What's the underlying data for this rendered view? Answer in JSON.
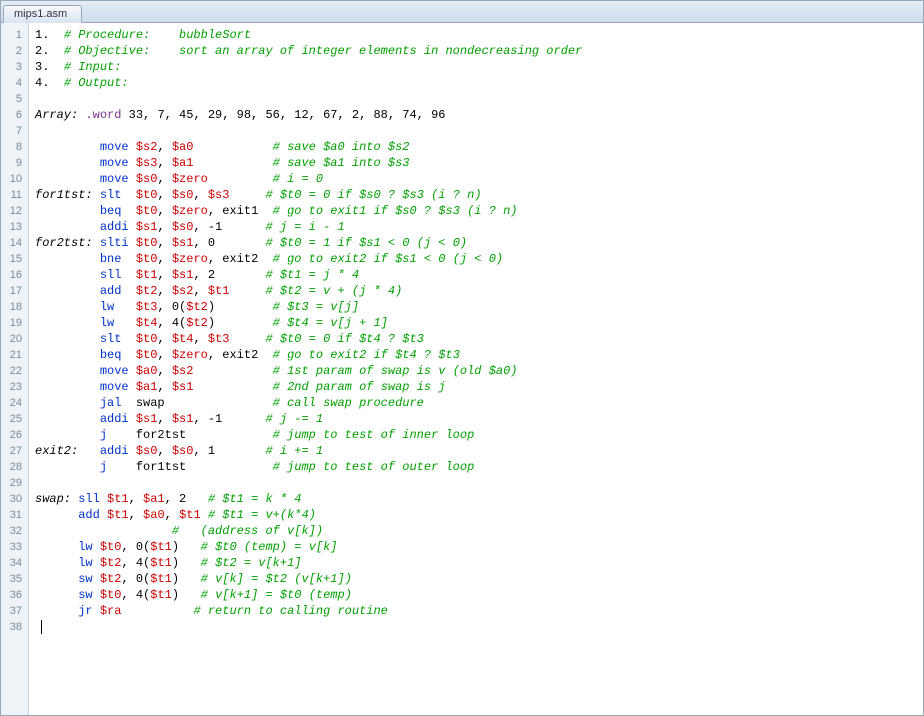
{
  "tab": {
    "label": "mips1.asm"
  },
  "gutter": [
    "1",
    "2",
    "3",
    "4",
    "5",
    "6",
    "7",
    "8",
    "9",
    "10",
    "11",
    "12",
    "13",
    "14",
    "15",
    "16",
    "17",
    "18",
    "19",
    "20",
    "21",
    "22",
    "23",
    "24",
    "25",
    "26",
    "27",
    "28",
    "29",
    "30",
    "31",
    "32",
    "33",
    "34",
    "35",
    "36",
    "37",
    "38"
  ],
  "lines": [
    [
      [
        "num",
        "1.  "
      ],
      [
        "comment",
        "# Procedure:    bubbleSort"
      ]
    ],
    [
      [
        "num",
        "2.  "
      ],
      [
        "comment",
        "# Objective:    sort an array of integer elements in nondecreasing order"
      ]
    ],
    [
      [
        "num",
        "3.  "
      ],
      [
        "comment",
        "# Input:"
      ]
    ],
    [
      [
        "num",
        "4.  "
      ],
      [
        "comment",
        "# Output:"
      ]
    ],
    [],
    [
      [
        "label",
        "Array:"
      ],
      [
        "plain",
        " "
      ],
      [
        "dir",
        ".word"
      ],
      [
        "plain",
        " 33, 7, 45, 29, 98, 56, 12, 67, 2, 88, 74, 96"
      ]
    ],
    [],
    [
      [
        "plain",
        "         "
      ],
      [
        "op",
        "move"
      ],
      [
        "plain",
        " "
      ],
      [
        "reg",
        "$s2"
      ],
      [
        "plain",
        ", "
      ],
      [
        "reg",
        "$a0"
      ],
      [
        "plain",
        "           "
      ],
      [
        "comment",
        "# save $a0 into $s2"
      ]
    ],
    [
      [
        "plain",
        "         "
      ],
      [
        "op",
        "move"
      ],
      [
        "plain",
        " "
      ],
      [
        "reg",
        "$s3"
      ],
      [
        "plain",
        ", "
      ],
      [
        "reg",
        "$a1"
      ],
      [
        "plain",
        "           "
      ],
      [
        "comment",
        "# save $a1 into $s3"
      ]
    ],
    [
      [
        "plain",
        "         "
      ],
      [
        "op",
        "move"
      ],
      [
        "plain",
        " "
      ],
      [
        "reg",
        "$s0"
      ],
      [
        "plain",
        ", "
      ],
      [
        "reg",
        "$zero"
      ],
      [
        "plain",
        "         "
      ],
      [
        "comment",
        "# i = 0"
      ]
    ],
    [
      [
        "label",
        "for1tst:"
      ],
      [
        "plain",
        " "
      ],
      [
        "op",
        "slt"
      ],
      [
        "plain",
        "  "
      ],
      [
        "reg",
        "$t0"
      ],
      [
        "plain",
        ", "
      ],
      [
        "reg",
        "$s0"
      ],
      [
        "plain",
        ", "
      ],
      [
        "reg",
        "$s3"
      ],
      [
        "plain",
        "     "
      ],
      [
        "comment",
        "# $t0 = 0 if $s0 ? $s3 (i ? n)"
      ]
    ],
    [
      [
        "plain",
        "         "
      ],
      [
        "op",
        "beq"
      ],
      [
        "plain",
        "  "
      ],
      [
        "reg",
        "$t0"
      ],
      [
        "plain",
        ", "
      ],
      [
        "reg",
        "$zero"
      ],
      [
        "plain",
        ", exit1  "
      ],
      [
        "comment",
        "# go to exit1 if $s0 ? $s3 (i ? n)"
      ]
    ],
    [
      [
        "plain",
        "         "
      ],
      [
        "op",
        "addi"
      ],
      [
        "plain",
        " "
      ],
      [
        "reg",
        "$s1"
      ],
      [
        "plain",
        ", "
      ],
      [
        "reg",
        "$s0"
      ],
      [
        "plain",
        ", -1      "
      ],
      [
        "comment",
        "# j = i - 1"
      ]
    ],
    [
      [
        "label",
        "for2tst:"
      ],
      [
        "plain",
        " "
      ],
      [
        "op",
        "slti"
      ],
      [
        "plain",
        " "
      ],
      [
        "reg",
        "$t0"
      ],
      [
        "plain",
        ", "
      ],
      [
        "reg",
        "$s1"
      ],
      [
        "plain",
        ", 0       "
      ],
      [
        "comment",
        "# $t0 = 1 if $s1 < 0 (j < 0)"
      ]
    ],
    [
      [
        "plain",
        "         "
      ],
      [
        "op",
        "bne"
      ],
      [
        "plain",
        "  "
      ],
      [
        "reg",
        "$t0"
      ],
      [
        "plain",
        ", "
      ],
      [
        "reg",
        "$zero"
      ],
      [
        "plain",
        ", exit2  "
      ],
      [
        "comment",
        "# go to exit2 if $s1 < 0 (j < 0)"
      ]
    ],
    [
      [
        "plain",
        "         "
      ],
      [
        "op",
        "sll"
      ],
      [
        "plain",
        "  "
      ],
      [
        "reg",
        "$t1"
      ],
      [
        "plain",
        ", "
      ],
      [
        "reg",
        "$s1"
      ],
      [
        "plain",
        ", 2       "
      ],
      [
        "comment",
        "# $t1 = j * 4"
      ]
    ],
    [
      [
        "plain",
        "         "
      ],
      [
        "op",
        "add"
      ],
      [
        "plain",
        "  "
      ],
      [
        "reg",
        "$t2"
      ],
      [
        "plain",
        ", "
      ],
      [
        "reg",
        "$s2"
      ],
      [
        "plain",
        ", "
      ],
      [
        "reg",
        "$t1"
      ],
      [
        "plain",
        "     "
      ],
      [
        "comment",
        "# $t2 = v + (j * 4)"
      ]
    ],
    [
      [
        "plain",
        "         "
      ],
      [
        "op",
        "lw"
      ],
      [
        "plain",
        "   "
      ],
      [
        "reg",
        "$t3"
      ],
      [
        "plain",
        ", 0("
      ],
      [
        "reg",
        "$t2"
      ],
      [
        "plain",
        ")        "
      ],
      [
        "comment",
        "# $t3 = v[j]"
      ]
    ],
    [
      [
        "plain",
        "         "
      ],
      [
        "op",
        "lw"
      ],
      [
        "plain",
        "   "
      ],
      [
        "reg",
        "$t4"
      ],
      [
        "plain",
        ", 4("
      ],
      [
        "reg",
        "$t2"
      ],
      [
        "plain",
        ")        "
      ],
      [
        "comment",
        "# $t4 = v[j + 1]"
      ]
    ],
    [
      [
        "plain",
        "         "
      ],
      [
        "op",
        "slt"
      ],
      [
        "plain",
        "  "
      ],
      [
        "reg",
        "$t0"
      ],
      [
        "plain",
        ", "
      ],
      [
        "reg",
        "$t4"
      ],
      [
        "plain",
        ", "
      ],
      [
        "reg",
        "$t3"
      ],
      [
        "plain",
        "     "
      ],
      [
        "comment",
        "# $t0 = 0 if $t4 ? $t3"
      ]
    ],
    [
      [
        "plain",
        "         "
      ],
      [
        "op",
        "beq"
      ],
      [
        "plain",
        "  "
      ],
      [
        "reg",
        "$t0"
      ],
      [
        "plain",
        ", "
      ],
      [
        "reg",
        "$zero"
      ],
      [
        "plain",
        ", exit2  "
      ],
      [
        "comment",
        "# go to exit2 if $t4 ? $t3"
      ]
    ],
    [
      [
        "plain",
        "         "
      ],
      [
        "op",
        "move"
      ],
      [
        "plain",
        " "
      ],
      [
        "reg",
        "$a0"
      ],
      [
        "plain",
        ", "
      ],
      [
        "reg",
        "$s2"
      ],
      [
        "plain",
        "           "
      ],
      [
        "comment",
        "# 1st param of swap is v (old $a0)"
      ]
    ],
    [
      [
        "plain",
        "         "
      ],
      [
        "op",
        "move"
      ],
      [
        "plain",
        " "
      ],
      [
        "reg",
        "$a1"
      ],
      [
        "plain",
        ", "
      ],
      [
        "reg",
        "$s1"
      ],
      [
        "plain",
        "           "
      ],
      [
        "comment",
        "# 2nd param of swap is j"
      ]
    ],
    [
      [
        "plain",
        "         "
      ],
      [
        "op",
        "jal"
      ],
      [
        "plain",
        "  swap               "
      ],
      [
        "comment",
        "# call swap procedure"
      ]
    ],
    [
      [
        "plain",
        "         "
      ],
      [
        "op",
        "addi"
      ],
      [
        "plain",
        " "
      ],
      [
        "reg",
        "$s1"
      ],
      [
        "plain",
        ", "
      ],
      [
        "reg",
        "$s1"
      ],
      [
        "plain",
        ", -1      "
      ],
      [
        "comment",
        "# j -= 1"
      ]
    ],
    [
      [
        "plain",
        "         "
      ],
      [
        "op",
        "j"
      ],
      [
        "plain",
        "    for2tst            "
      ],
      [
        "comment",
        "# jump to test of inner loop"
      ]
    ],
    [
      [
        "label",
        "exit2:"
      ],
      [
        "plain",
        "   "
      ],
      [
        "op",
        "addi"
      ],
      [
        "plain",
        " "
      ],
      [
        "reg",
        "$s0"
      ],
      [
        "plain",
        ", "
      ],
      [
        "reg",
        "$s0"
      ],
      [
        "plain",
        ", 1       "
      ],
      [
        "comment",
        "# i += 1"
      ]
    ],
    [
      [
        "plain",
        "         "
      ],
      [
        "op",
        "j"
      ],
      [
        "plain",
        "    for1tst            "
      ],
      [
        "comment",
        "# jump to test of outer loop"
      ]
    ],
    [],
    [
      [
        "label",
        "swap:"
      ],
      [
        "plain",
        " "
      ],
      [
        "op",
        "sll"
      ],
      [
        "plain",
        " "
      ],
      [
        "reg",
        "$t1"
      ],
      [
        "plain",
        ", "
      ],
      [
        "reg",
        "$a1"
      ],
      [
        "plain",
        ", 2   "
      ],
      [
        "comment",
        "# $t1 = k * 4"
      ]
    ],
    [
      [
        "plain",
        "      "
      ],
      [
        "op",
        "add"
      ],
      [
        "plain",
        " "
      ],
      [
        "reg",
        "$t1"
      ],
      [
        "plain",
        ", "
      ],
      [
        "reg",
        "$a0"
      ],
      [
        "plain",
        ", "
      ],
      [
        "reg",
        "$t1"
      ],
      [
        "plain",
        " "
      ],
      [
        "comment",
        "# $t1 = v+(k*4)"
      ]
    ],
    [
      [
        "plain",
        "                   "
      ],
      [
        "comment",
        "#   (address of v[k])"
      ]
    ],
    [
      [
        "plain",
        "      "
      ],
      [
        "op",
        "lw"
      ],
      [
        "plain",
        " "
      ],
      [
        "reg",
        "$t0"
      ],
      [
        "plain",
        ", 0("
      ],
      [
        "reg",
        "$t1"
      ],
      [
        "plain",
        ")   "
      ],
      [
        "comment",
        "# $t0 (temp) = v[k]"
      ]
    ],
    [
      [
        "plain",
        "      "
      ],
      [
        "op",
        "lw"
      ],
      [
        "plain",
        " "
      ],
      [
        "reg",
        "$t2"
      ],
      [
        "plain",
        ", 4("
      ],
      [
        "reg",
        "$t1"
      ],
      [
        "plain",
        ")   "
      ],
      [
        "comment",
        "# $t2 = v[k+1]"
      ]
    ],
    [
      [
        "plain",
        "      "
      ],
      [
        "op",
        "sw"
      ],
      [
        "plain",
        " "
      ],
      [
        "reg",
        "$t2"
      ],
      [
        "plain",
        ", 0("
      ],
      [
        "reg",
        "$t1"
      ],
      [
        "plain",
        ")   "
      ],
      [
        "comment",
        "# v[k] = $t2 (v[k+1])"
      ]
    ],
    [
      [
        "plain",
        "      "
      ],
      [
        "op",
        "sw"
      ],
      [
        "plain",
        " "
      ],
      [
        "reg",
        "$t0"
      ],
      [
        "plain",
        ", 4("
      ],
      [
        "reg",
        "$t1"
      ],
      [
        "plain",
        ")   "
      ],
      [
        "comment",
        "# v[k+1] = $t0 (temp)"
      ]
    ],
    [
      [
        "plain",
        "      "
      ],
      [
        "op",
        "jr"
      ],
      [
        "plain",
        " "
      ],
      [
        "reg",
        "$ra"
      ],
      [
        "plain",
        "          "
      ],
      [
        "comment",
        "# return to calling routine"
      ]
    ],
    []
  ]
}
